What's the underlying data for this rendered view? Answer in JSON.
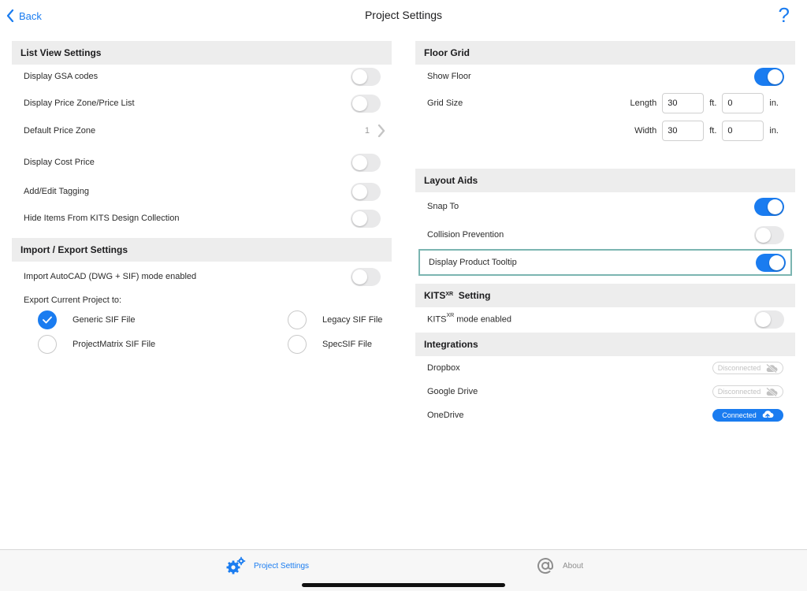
{
  "nav": {
    "back_label": "Back",
    "title": "Project Settings",
    "help_glyph": "?"
  },
  "colors": {
    "accent": "#1a7cf0",
    "section_bg": "#ededed",
    "highlight_border": "#7bb5b1",
    "toggle_off": "#e9e9ea"
  },
  "list_view": {
    "header": "List View Settings",
    "rows": [
      {
        "label": "Display GSA codes",
        "toggle": false
      },
      {
        "label": "Display Price Zone/Price List",
        "toggle": false
      },
      {
        "label": "Default Price Zone",
        "value": "1"
      },
      {
        "label": "Display Cost Price",
        "toggle": false
      },
      {
        "label": "Add/Edit Tagging",
        "toggle": false
      },
      {
        "label": "Hide Items From KITS Design Collection",
        "toggle": false
      }
    ]
  },
  "import_export": {
    "header": "Import / Export Settings",
    "import_label": "Import AutoCAD (DWG + SIF) mode enabled",
    "import_toggle": false,
    "export_label": "Export Current Project to:",
    "options": [
      {
        "label": "Generic SIF File",
        "checked": true
      },
      {
        "label": "Legacy SIF File",
        "checked": false
      },
      {
        "label": "ProjectMatrix SIF File",
        "checked": false
      },
      {
        "label": "SpecSIF File",
        "checked": false
      }
    ]
  },
  "floor_grid": {
    "header": "Floor Grid",
    "show_floor_label": "Show Floor",
    "show_floor": true,
    "grid_size_label": "Grid Size",
    "length_label": "Length",
    "width_label": "Width",
    "length_ft": "30",
    "length_in": "0",
    "width_ft": "30",
    "width_in": "0",
    "ft_unit": "ft.",
    "in_unit": "in."
  },
  "layout_aids": {
    "header": "Layout Aids",
    "rows": [
      {
        "label": "Snap To",
        "toggle": true
      },
      {
        "label": "Collision Prevention",
        "toggle": false
      },
      {
        "label": "Display Product Tooltip",
        "toggle": true
      }
    ]
  },
  "kits_xr": {
    "header_prefix": "KITS",
    "header_sup": "XR",
    "header_suffix": "Setting",
    "row_prefix": "KITS",
    "row_sup": "XR",
    "row_suffix": " mode enabled",
    "toggle": false
  },
  "integrations": {
    "header": "Integrations",
    "rows": [
      {
        "label": "Dropbox",
        "status": "Disconnected",
        "connected": false,
        "icon": "cloud-off-icon"
      },
      {
        "label": "Google Drive",
        "status": "Disconnected",
        "connected": false,
        "icon": "cloud-off-icon"
      },
      {
        "label": "OneDrive",
        "status": "Connected",
        "connected": true,
        "icon": "cloud-upload-icon"
      }
    ]
  },
  "tabbar": {
    "project_label": "Project Settings",
    "project_icon": "gears-icon",
    "about_label": "About",
    "about_icon": "at-sign-icon"
  }
}
